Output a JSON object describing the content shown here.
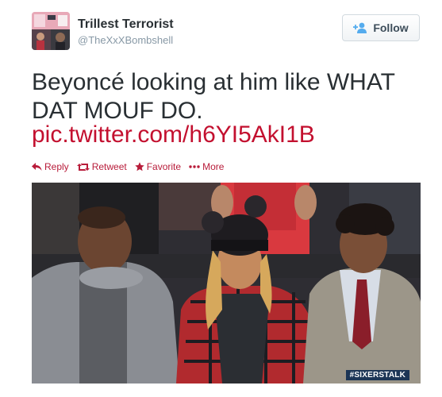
{
  "user": {
    "display_name": "Trillest Terrorist",
    "screen_name": "@TheXxXBombshell",
    "avatar_icon": "profile-photo-collage"
  },
  "follow_button": {
    "label": "Follow",
    "icon": "add-user-icon"
  },
  "tweet": {
    "text": "Beyoncé looking at him like WHAT DAT MOUF DO.",
    "link": "pic.twitter.com/h6YI5AkI1B"
  },
  "actions": [
    {
      "label": "Reply",
      "icon": "reply-icon"
    },
    {
      "label": "Retweet",
      "icon": "retweet-icon"
    },
    {
      "label": "Favorite",
      "icon": "star-icon"
    },
    {
      "label": "More",
      "icon": "more-dots-icon"
    }
  ],
  "media": {
    "watermark": "#SIXERSTALK"
  },
  "colors": {
    "link": "#c3102f",
    "action": "#b81c3a",
    "name": "#292f33",
    "handle": "#8899a6"
  }
}
